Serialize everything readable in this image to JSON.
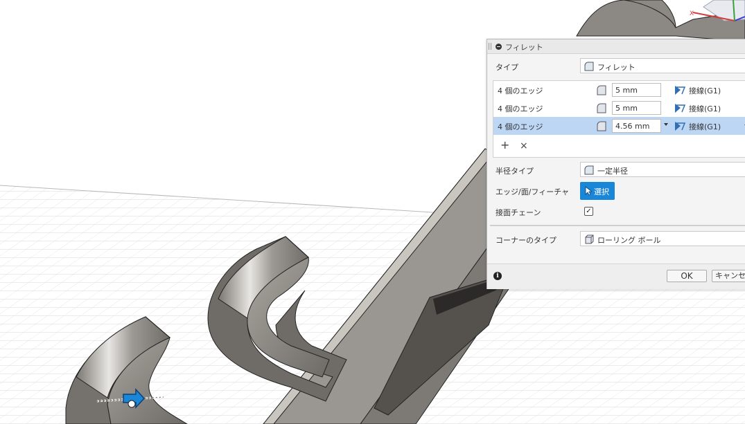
{
  "dialog": {
    "title": "フィレット",
    "type_label": "タイプ",
    "type_value": "フィレット",
    "edges": [
      {
        "name": "4 個のエッジ",
        "value": "5 mm",
        "continuity": "接線(G1)",
        "selected": false
      },
      {
        "name": "4 個のエッジ",
        "value": "5 mm",
        "continuity": "接線(G1)",
        "selected": false
      },
      {
        "name": "4 個のエッジ",
        "value": "4.56 mm",
        "continuity": "接線(G1)",
        "selected": true
      }
    ],
    "add_symbol": "+",
    "remove_symbol": "×",
    "radius_type_label": "半径タイプ",
    "radius_type_value": "一定半径",
    "edge_face_feature_label": "エッジ/面/フィーチャ",
    "select_button": "選択",
    "tangent_chain_label": "接面チェーン",
    "tangent_chain_checked": true,
    "corner_type_label": "コーナーのタイプ",
    "corner_type_value": "ローリング ボール",
    "info_symbol": "i",
    "ok_button": "OK",
    "cancel_button": "キャンセル"
  },
  "viewcube": {
    "axis_x": "X"
  },
  "colors": {
    "accent": "#1a86d8",
    "selected_row": "#bcd6f4",
    "model_gray": "#8a8884"
  }
}
